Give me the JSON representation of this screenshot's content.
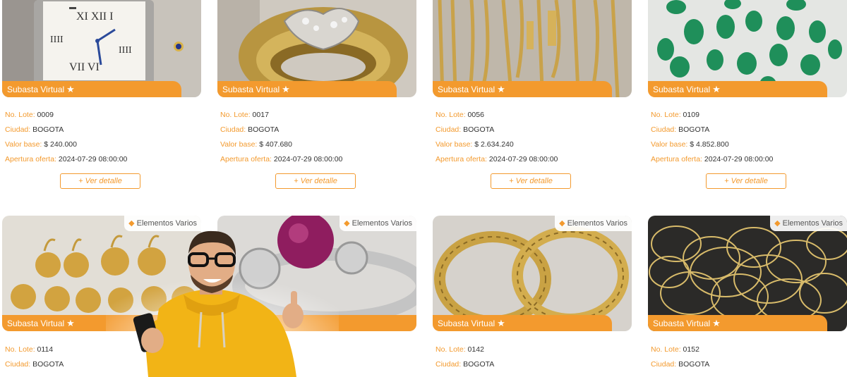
{
  "labels": {
    "lote": "No. Lote:",
    "ciudad": "Ciudad:",
    "valor": "Valor base:",
    "apertura": "Apertura oferta:",
    "banner": "Subasta Virtual",
    "detail": "+ Ver detalle"
  },
  "icons": {
    "banner": "star-icon",
    "category": "tag-icon"
  },
  "colors": {
    "accent": "#f39a2e",
    "text": "#333333"
  },
  "cards": [
    {
      "lote": "0009",
      "ciudad": "BOGOTA",
      "valor": "$ 240.000",
      "apertura": "2024-07-29 08:00:00",
      "image": "cartier-watch"
    },
    {
      "lote": "0017",
      "ciudad": "BOGOTA",
      "valor": "$ 407.680",
      "apertura": "2024-07-29 08:00:00",
      "image": "gold-diamond-ring"
    },
    {
      "lote": "0056",
      "ciudad": "BOGOTA",
      "valor": "$ 2.634.240",
      "apertura": "2024-07-29 08:00:00",
      "image": "gold-chains"
    },
    {
      "lote": "0109",
      "ciudad": "BOGOTA",
      "valor": "$ 4.852.800",
      "apertura": "2024-07-29 08:00:00",
      "image": "emeralds"
    },
    {
      "category": "Elementos Varios",
      "lote": "0114",
      "ciudad": "BOGOTA",
      "image": "gold-earrings"
    },
    {
      "category": "Elementos Varios",
      "image": "ruby-ring"
    },
    {
      "category": "Elementos Varios",
      "lote": "0142",
      "ciudad": "BOGOTA",
      "image": "gold-hoops"
    },
    {
      "category": "Elementos Varios",
      "lote": "0152",
      "ciudad": "BOGOTA",
      "image": "gold-bangles"
    }
  ]
}
